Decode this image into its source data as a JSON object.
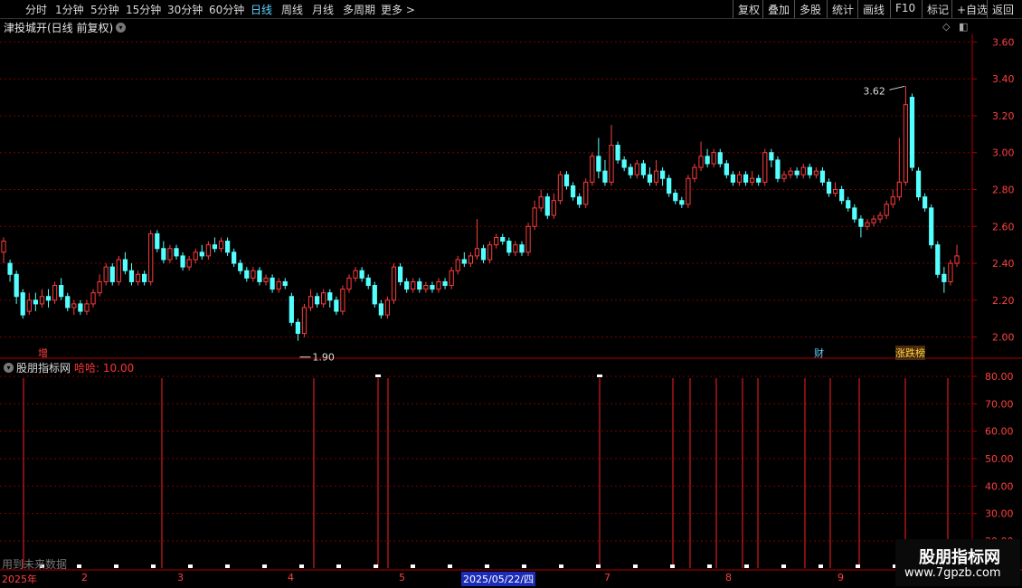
{
  "toolbar": {
    "periods": [
      "分时",
      "1分钟",
      "5分钟",
      "15分钟",
      "30分钟",
      "60分钟",
      "日线",
      "周线",
      "月线",
      "多周期",
      "更多 >"
    ],
    "active_period": "日线",
    "actions": [
      "复权",
      "叠加",
      "多股",
      "统计",
      "画线",
      "F10",
      "标记",
      "+自选",
      "返回"
    ]
  },
  "stock": {
    "title": "津投城开(日线 前复权)",
    "high_label": "3.62",
    "low_label": "1.90"
  },
  "price_axis": {
    "labels": [
      "3.60",
      "3.40",
      "3.20",
      "3.00",
      "2.80",
      "2.60",
      "2.40",
      "2.20",
      "2.00"
    ],
    "ylim": [
      1.9,
      3.7
    ]
  },
  "markers": {
    "zeng": "增",
    "cai": "财",
    "zhangdiebang": "涨跌榜"
  },
  "indicator": {
    "name": "股朋指标网",
    "value_label": "哈哈: 10.00",
    "axis_labels": [
      "80.00",
      "70.00",
      "60.00",
      "50.00",
      "40.00",
      "30.00",
      "20.00"
    ]
  },
  "footer": {
    "note": "用到未来数据",
    "dates": [
      "2025年",
      "2",
      "3",
      "4",
      "5",
      "2025/05/22/四",
      "7",
      "8",
      "9"
    ]
  },
  "watermark": {
    "name": "股朋指标网",
    "url": "www.7gpzb.com"
  },
  "colors": {
    "up": "#ff3b3b",
    "down": "#54ffff",
    "grid": "#7a0000",
    "active": "#5fd3ff"
  },
  "chart_data": {
    "type": "candlestick",
    "ylim": [
      1.9,
      3.7
    ],
    "candles": [
      [
        2.46,
        2.52,
        2.4,
        2.54
      ],
      [
        2.4,
        2.34,
        2.3,
        2.42
      ],
      [
        2.34,
        2.22,
        2.18,
        2.36
      ],
      [
        2.24,
        2.12,
        2.1,
        2.26
      ],
      [
        2.14,
        2.2,
        2.12,
        2.24
      ],
      [
        2.2,
        2.18,
        2.14,
        2.24
      ],
      [
        2.18,
        2.22,
        2.16,
        2.26
      ],
      [
        2.22,
        2.2,
        2.16,
        2.26
      ],
      [
        2.2,
        2.28,
        2.18,
        2.3
      ],
      [
        2.28,
        2.22,
        2.2,
        2.32
      ],
      [
        2.22,
        2.16,
        2.14,
        2.24
      ],
      [
        2.16,
        2.18,
        2.12,
        2.2
      ],
      [
        2.18,
        2.14,
        2.12,
        2.2
      ],
      [
        2.14,
        2.18,
        2.12,
        2.2
      ],
      [
        2.18,
        2.24,
        2.16,
        2.26
      ],
      [
        2.24,
        2.3,
        2.22,
        2.34
      ],
      [
        2.3,
        2.38,
        2.28,
        2.4
      ],
      [
        2.38,
        2.3,
        2.28,
        2.4
      ],
      [
        2.3,
        2.42,
        2.28,
        2.44
      ],
      [
        2.42,
        2.36,
        2.34,
        2.46
      ],
      [
        2.36,
        2.3,
        2.28,
        2.4
      ],
      [
        2.3,
        2.34,
        2.28,
        2.36
      ],
      [
        2.34,
        2.3,
        2.28,
        2.36
      ],
      [
        2.3,
        2.56,
        2.28,
        2.58
      ],
      [
        2.56,
        2.48,
        2.46,
        2.58
      ],
      [
        2.48,
        2.42,
        2.4,
        2.52
      ],
      [
        2.42,
        2.48,
        2.4,
        2.5
      ],
      [
        2.48,
        2.44,
        2.42,
        2.5
      ],
      [
        2.44,
        2.38,
        2.36,
        2.46
      ],
      [
        2.38,
        2.42,
        2.36,
        2.44
      ],
      [
        2.42,
        2.46,
        2.4,
        2.48
      ],
      [
        2.46,
        2.44,
        2.42,
        2.5
      ],
      [
        2.44,
        2.5,
        2.42,
        2.52
      ],
      [
        2.5,
        2.48,
        2.46,
        2.54
      ],
      [
        2.48,
        2.52,
        2.46,
        2.54
      ],
      [
        2.52,
        2.46,
        2.44,
        2.54
      ],
      [
        2.46,
        2.4,
        2.38,
        2.48
      ],
      [
        2.4,
        2.36,
        2.34,
        2.42
      ],
      [
        2.36,
        2.32,
        2.3,
        2.38
      ],
      [
        2.32,
        2.36,
        2.3,
        2.38
      ],
      [
        2.36,
        2.3,
        2.28,
        2.38
      ],
      [
        2.3,
        2.32,
        2.28,
        2.34
      ],
      [
        2.32,
        2.26,
        2.24,
        2.34
      ],
      [
        2.26,
        2.3,
        2.24,
        2.32
      ],
      [
        2.3,
        2.28,
        2.26,
        2.32
      ],
      [
        2.22,
        2.08,
        2.06,
        2.24
      ],
      [
        2.08,
        2.02,
        1.98,
        2.1
      ],
      [
        2.02,
        2.16,
        2.0,
        2.18
      ],
      [
        2.16,
        2.22,
        2.14,
        2.26
      ],
      [
        2.22,
        2.18,
        2.16,
        2.24
      ],
      [
        2.18,
        2.24,
        2.16,
        2.26
      ],
      [
        2.24,
        2.2,
        2.16,
        2.26
      ],
      [
        2.2,
        2.14,
        2.12,
        2.22
      ],
      [
        2.14,
        2.26,
        2.12,
        2.28
      ],
      [
        2.26,
        2.32,
        2.24,
        2.34
      ],
      [
        2.32,
        2.36,
        2.3,
        2.38
      ],
      [
        2.36,
        2.32,
        2.3,
        2.38
      ],
      [
        2.32,
        2.28,
        2.26,
        2.34
      ],
      [
        2.28,
        2.18,
        2.16,
        2.3
      ],
      [
        2.18,
        2.12,
        2.1,
        2.2
      ],
      [
        2.12,
        2.2,
        2.1,
        2.22
      ],
      [
        2.2,
        2.38,
        2.18,
        2.4
      ],
      [
        2.38,
        2.3,
        2.28,
        2.4
      ],
      [
        2.3,
        2.26,
        2.24,
        2.32
      ],
      [
        2.26,
        2.3,
        2.24,
        2.32
      ],
      [
        2.3,
        2.26,
        2.24,
        2.32
      ],
      [
        2.26,
        2.28,
        2.24,
        2.3
      ],
      [
        2.28,
        2.26,
        2.24,
        2.3
      ],
      [
        2.26,
        2.3,
        2.24,
        2.32
      ],
      [
        2.3,
        2.28,
        2.26,
        2.32
      ],
      [
        2.28,
        2.36,
        2.26,
        2.38
      ],
      [
        2.36,
        2.42,
        2.34,
        2.44
      ],
      [
        2.42,
        2.4,
        2.38,
        2.46
      ],
      [
        2.4,
        2.44,
        2.38,
        2.46
      ],
      [
        2.44,
        2.48,
        2.42,
        2.64
      ],
      [
        2.48,
        2.42,
        2.4,
        2.5
      ],
      [
        2.42,
        2.5,
        2.4,
        2.52
      ],
      [
        2.5,
        2.54,
        2.48,
        2.56
      ],
      [
        2.54,
        2.52,
        2.5,
        2.56
      ],
      [
        2.52,
        2.46,
        2.44,
        2.54
      ],
      [
        2.46,
        2.5,
        2.44,
        2.52
      ],
      [
        2.5,
        2.46,
        2.44,
        2.52
      ],
      [
        2.46,
        2.6,
        2.44,
        2.62
      ],
      [
        2.6,
        2.7,
        2.58,
        2.74
      ],
      [
        2.7,
        2.76,
        2.68,
        2.8
      ],
      [
        2.76,
        2.66,
        2.64,
        2.78
      ],
      [
        2.66,
        2.74,
        2.64,
        2.78
      ],
      [
        2.74,
        2.88,
        2.72,
        2.9
      ],
      [
        2.88,
        2.82,
        2.8,
        2.9
      ],
      [
        2.82,
        2.76,
        2.74,
        2.84
      ],
      [
        2.76,
        2.72,
        2.7,
        2.78
      ],
      [
        2.72,
        2.84,
        2.7,
        2.86
      ],
      [
        2.84,
        2.98,
        2.82,
        3.0
      ],
      [
        2.98,
        2.9,
        2.86,
        3.08
      ],
      [
        2.9,
        2.84,
        2.82,
        2.96
      ],
      [
        2.84,
        3.04,
        2.82,
        3.15
      ],
      [
        3.04,
        2.96,
        2.94,
        3.06
      ],
      [
        2.96,
        2.92,
        2.9,
        2.98
      ],
      [
        2.92,
        2.88,
        2.86,
        2.94
      ],
      [
        2.88,
        2.94,
        2.86,
        2.96
      ],
      [
        2.94,
        2.88,
        2.86,
        2.96
      ],
      [
        2.88,
        2.84,
        2.82,
        2.92
      ],
      [
        2.84,
        2.9,
        2.82,
        2.96
      ],
      [
        2.9,
        2.86,
        2.82,
        2.92
      ],
      [
        2.86,
        2.78,
        2.76,
        2.88
      ],
      [
        2.78,
        2.74,
        2.72,
        2.8
      ],
      [
        2.74,
        2.72,
        2.7,
        2.76
      ],
      [
        2.72,
        2.86,
        2.7,
        2.88
      ],
      [
        2.86,
        2.92,
        2.84,
        2.94
      ],
      [
        2.92,
        2.98,
        2.9,
        3.06
      ],
      [
        2.98,
        2.94,
        2.92,
        3.02
      ],
      [
        2.94,
        3.0,
        2.92,
        3.02
      ],
      [
        3.0,
        2.94,
        2.92,
        3.02
      ],
      [
        2.94,
        2.88,
        2.86,
        2.96
      ],
      [
        2.88,
        2.84,
        2.82,
        2.9
      ],
      [
        2.84,
        2.88,
        2.82,
        2.9
      ],
      [
        2.88,
        2.84,
        2.82,
        2.9
      ],
      [
        2.84,
        2.86,
        2.82,
        2.9
      ],
      [
        2.86,
        2.84,
        2.82,
        2.88
      ],
      [
        2.84,
        3.0,
        2.82,
        3.02
      ],
      [
        3.0,
        2.96,
        2.92,
        3.02
      ],
      [
        2.96,
        2.86,
        2.84,
        2.98
      ],
      [
        2.86,
        2.88,
        2.84,
        2.9
      ],
      [
        2.88,
        2.9,
        2.86,
        2.92
      ],
      [
        2.9,
        2.88,
        2.86,
        2.92
      ],
      [
        2.88,
        2.92,
        2.86,
        2.94
      ],
      [
        2.92,
        2.88,
        2.86,
        2.94
      ],
      [
        2.88,
        2.9,
        2.86,
        2.92
      ],
      [
        2.9,
        2.84,
        2.82,
        2.92
      ],
      [
        2.84,
        2.78,
        2.76,
        2.86
      ],
      [
        2.78,
        2.8,
        2.76,
        2.84
      ],
      [
        2.8,
        2.74,
        2.72,
        2.82
      ],
      [
        2.74,
        2.7,
        2.68,
        2.76
      ],
      [
        2.7,
        2.64,
        2.62,
        2.72
      ],
      [
        2.64,
        2.6,
        2.54,
        2.66
      ],
      [
        2.6,
        2.62,
        2.58,
        2.64
      ],
      [
        2.62,
        2.64,
        2.6,
        2.66
      ],
      [
        2.64,
        2.66,
        2.62,
        2.68
      ],
      [
        2.66,
        2.72,
        2.64,
        2.74
      ],
      [
        2.72,
        2.76,
        2.7,
        2.8
      ],
      [
        2.76,
        2.84,
        2.74,
        3.08
      ],
      [
        2.84,
        3.26,
        2.82,
        3.36
      ],
      [
        3.3,
        2.92,
        2.9,
        3.32
      ],
      [
        2.9,
        2.76,
        2.74,
        2.92
      ],
      [
        2.76,
        2.7,
        2.68,
        2.78
      ],
      [
        2.7,
        2.5,
        2.48,
        2.72
      ],
      [
        2.5,
        2.34,
        2.32,
        2.52
      ],
      [
        2.34,
        2.3,
        2.24,
        2.38
      ],
      [
        2.3,
        2.4,
        2.28,
        2.42
      ],
      [
        2.4,
        2.44,
        2.38,
        2.5
      ]
    ],
    "indicator": {
      "name": "股朋指标网",
      "axis_labels": [
        "80.00",
        "70.00",
        "60.00",
        "50.00",
        "40.00",
        "30.00",
        "20.00"
      ]
    }
  }
}
